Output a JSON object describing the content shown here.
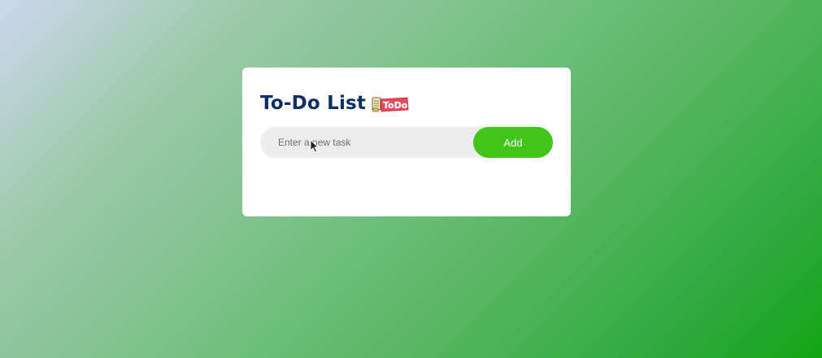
{
  "app": {
    "title": "To-Do List",
    "title_icon": "todo-sticker-icon",
    "colors": {
      "title": "#0c2e63",
      "accent": "#42c41a",
      "input_bg": "#ededee",
      "card_bg": "#ffffff"
    }
  },
  "task_input": {
    "value": "",
    "placeholder": "Enter a new task"
  },
  "add_button": {
    "label": "Add"
  },
  "tasks": []
}
